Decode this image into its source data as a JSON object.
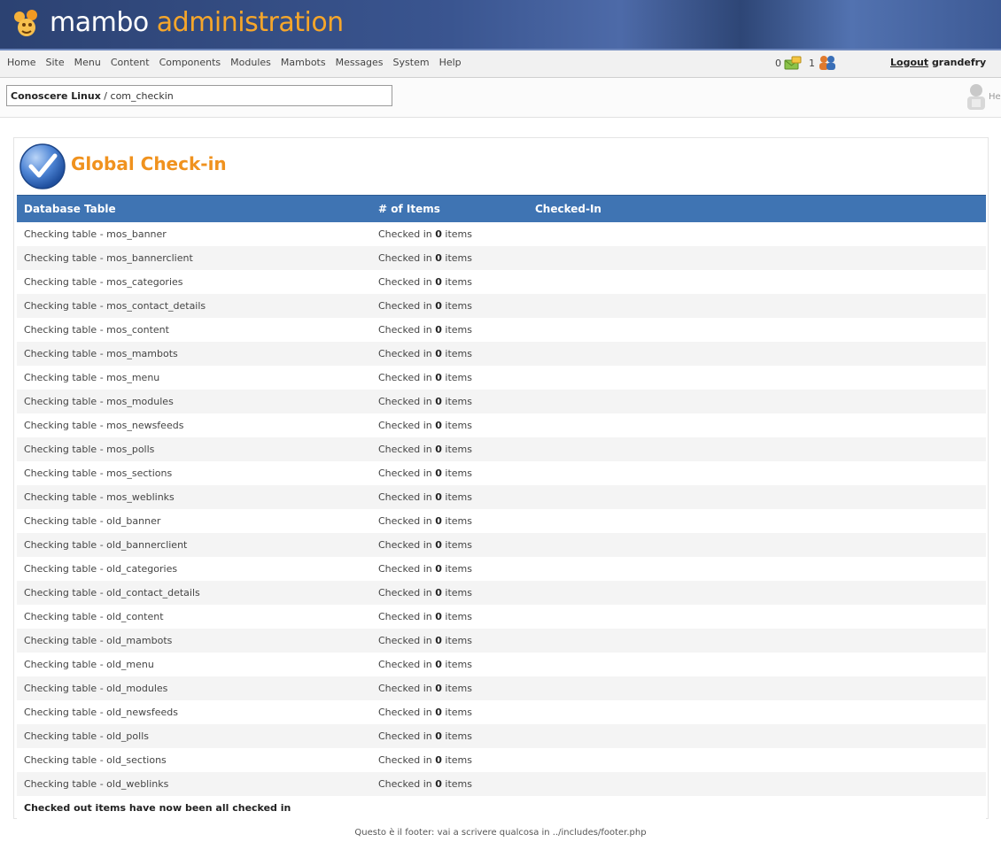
{
  "header": {
    "logo_word1": "mambo",
    "logo_word2": "administration"
  },
  "menu": {
    "items": [
      "Home",
      "Site",
      "Menu",
      "Content",
      "Components",
      "Modules",
      "Mambots",
      "Messages",
      "System",
      "Help"
    ]
  },
  "status": {
    "messages_count": "0",
    "users_count": "1",
    "logout_label": "Logout",
    "username": "grandefry"
  },
  "pathbar": {
    "site": "Conoscere Linux",
    "separator": " / ",
    "component": "com_checkin",
    "help_label": "Help"
  },
  "page": {
    "title": "Global Check-in"
  },
  "table": {
    "headers": [
      "Database Table",
      "# of Items",
      "Checked-In"
    ],
    "rows": [
      {
        "table": "Checking table - mos_banner",
        "prefix": "Checked in",
        "count": "0",
        "suffix": "items"
      },
      {
        "table": "Checking table - mos_bannerclient",
        "prefix": "Checked in",
        "count": "0",
        "suffix": "items"
      },
      {
        "table": "Checking table - mos_categories",
        "prefix": "Checked in",
        "count": "0",
        "suffix": "items"
      },
      {
        "table": "Checking table - mos_contact_details",
        "prefix": "Checked in",
        "count": "0",
        "suffix": "items"
      },
      {
        "table": "Checking table - mos_content",
        "prefix": "Checked in",
        "count": "0",
        "suffix": "items"
      },
      {
        "table": "Checking table - mos_mambots",
        "prefix": "Checked in",
        "count": "0",
        "suffix": "items"
      },
      {
        "table": "Checking table - mos_menu",
        "prefix": "Checked in",
        "count": "0",
        "suffix": "items"
      },
      {
        "table": "Checking table - mos_modules",
        "prefix": "Checked in",
        "count": "0",
        "suffix": "items"
      },
      {
        "table": "Checking table - mos_newsfeeds",
        "prefix": "Checked in",
        "count": "0",
        "suffix": "items"
      },
      {
        "table": "Checking table - mos_polls",
        "prefix": "Checked in",
        "count": "0",
        "suffix": "items"
      },
      {
        "table": "Checking table - mos_sections",
        "prefix": "Checked in",
        "count": "0",
        "suffix": "items"
      },
      {
        "table": "Checking table - mos_weblinks",
        "prefix": "Checked in",
        "count": "0",
        "suffix": "items"
      },
      {
        "table": "Checking table - old_banner",
        "prefix": "Checked in",
        "count": "0",
        "suffix": "items"
      },
      {
        "table": "Checking table - old_bannerclient",
        "prefix": "Checked in",
        "count": "0",
        "suffix": "items"
      },
      {
        "table": "Checking table - old_categories",
        "prefix": "Checked in",
        "count": "0",
        "suffix": "items"
      },
      {
        "table": "Checking table - old_contact_details",
        "prefix": "Checked in",
        "count": "0",
        "suffix": "items"
      },
      {
        "table": "Checking table - old_content",
        "prefix": "Checked in",
        "count": "0",
        "suffix": "items"
      },
      {
        "table": "Checking table - old_mambots",
        "prefix": "Checked in",
        "count": "0",
        "suffix": "items"
      },
      {
        "table": "Checking table - old_menu",
        "prefix": "Checked in",
        "count": "0",
        "suffix": "items"
      },
      {
        "table": "Checking table - old_modules",
        "prefix": "Checked in",
        "count": "0",
        "suffix": "items"
      },
      {
        "table": "Checking table - old_newsfeeds",
        "prefix": "Checked in",
        "count": "0",
        "suffix": "items"
      },
      {
        "table": "Checking table - old_polls",
        "prefix": "Checked in",
        "count": "0",
        "suffix": "items"
      },
      {
        "table": "Checking table - old_sections",
        "prefix": "Checked in",
        "count": "0",
        "suffix": "items"
      },
      {
        "table": "Checking table - old_weblinks",
        "prefix": "Checked in",
        "count": "0",
        "suffix": "items"
      }
    ],
    "summary": "Checked out items have now been all checked in"
  },
  "footer": {
    "text": "Questo è il footer: vai a scrivere qualcosa in ../includes/footer.php"
  },
  "colors": {
    "header_bg": "#3a5590",
    "logo_accent": "#f6a62a",
    "title": "#f0921e",
    "table_header": "#3f74b3",
    "row_alt": "#f4f4f4"
  },
  "icons": {
    "logo": "mambo-logo-icon",
    "messages": "messages-icon",
    "users": "users-icon",
    "help": "help-icon",
    "title": "checkmark-icon"
  }
}
